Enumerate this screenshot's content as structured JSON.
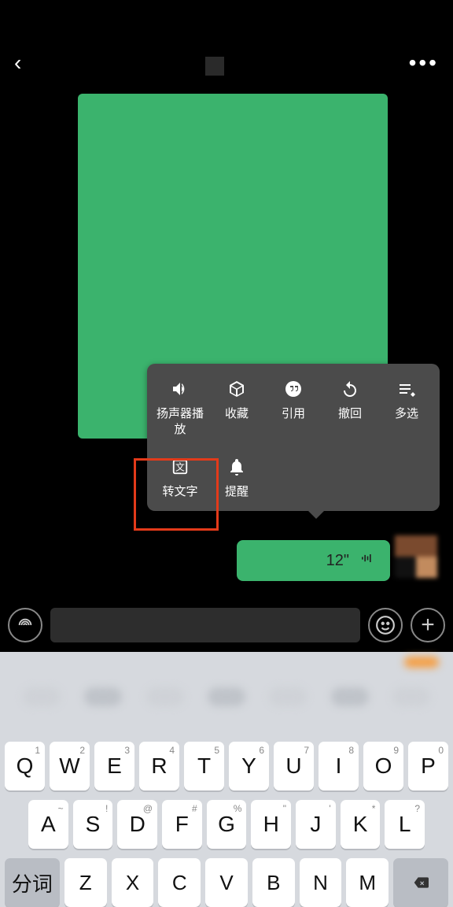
{
  "header": {
    "back_icon": "‹",
    "more_icon": "•••"
  },
  "ctx": {
    "row1": [
      {
        "icon": "speaker",
        "label": "扬声器播放"
      },
      {
        "icon": "cube",
        "label": "收藏"
      },
      {
        "icon": "quote",
        "label": "引用"
      },
      {
        "icon": "undo",
        "label": "撤回"
      },
      {
        "icon": "list",
        "label": "多选"
      }
    ],
    "row2": [
      {
        "icon": "text",
        "label": "转文字"
      },
      {
        "icon": "bell",
        "label": "提醒"
      }
    ]
  },
  "voice": {
    "duration": "12\""
  },
  "inputbar": {
    "voice_icon": "•))",
    "emoji_icon": "☺",
    "plus_icon": "+"
  },
  "keyboard": {
    "row1": [
      {
        "main": "Q",
        "sub": "1"
      },
      {
        "main": "W",
        "sub": "2"
      },
      {
        "main": "E",
        "sub": "3"
      },
      {
        "main": "R",
        "sub": "4"
      },
      {
        "main": "T",
        "sub": "5"
      },
      {
        "main": "Y",
        "sub": "6"
      },
      {
        "main": "U",
        "sub": "7"
      },
      {
        "main": "I",
        "sub": "8"
      },
      {
        "main": "O",
        "sub": "9"
      },
      {
        "main": "P",
        "sub": "0"
      }
    ],
    "row2": [
      {
        "main": "A",
        "sub": "~"
      },
      {
        "main": "S",
        "sub": "!"
      },
      {
        "main": "D",
        "sub": "@"
      },
      {
        "main": "F",
        "sub": "#"
      },
      {
        "main": "G",
        "sub": "%"
      },
      {
        "main": "H",
        "sub": "\""
      },
      {
        "main": "J",
        "sub": "'"
      },
      {
        "main": "K",
        "sub": "*"
      },
      {
        "main": "L",
        "sub": "?"
      }
    ],
    "row3_fn": "分词",
    "row3": [
      {
        "main": "Z"
      },
      {
        "main": "X"
      },
      {
        "main": "C"
      },
      {
        "main": "V"
      },
      {
        "main": "B"
      },
      {
        "main": "N"
      },
      {
        "main": "M"
      }
    ]
  }
}
